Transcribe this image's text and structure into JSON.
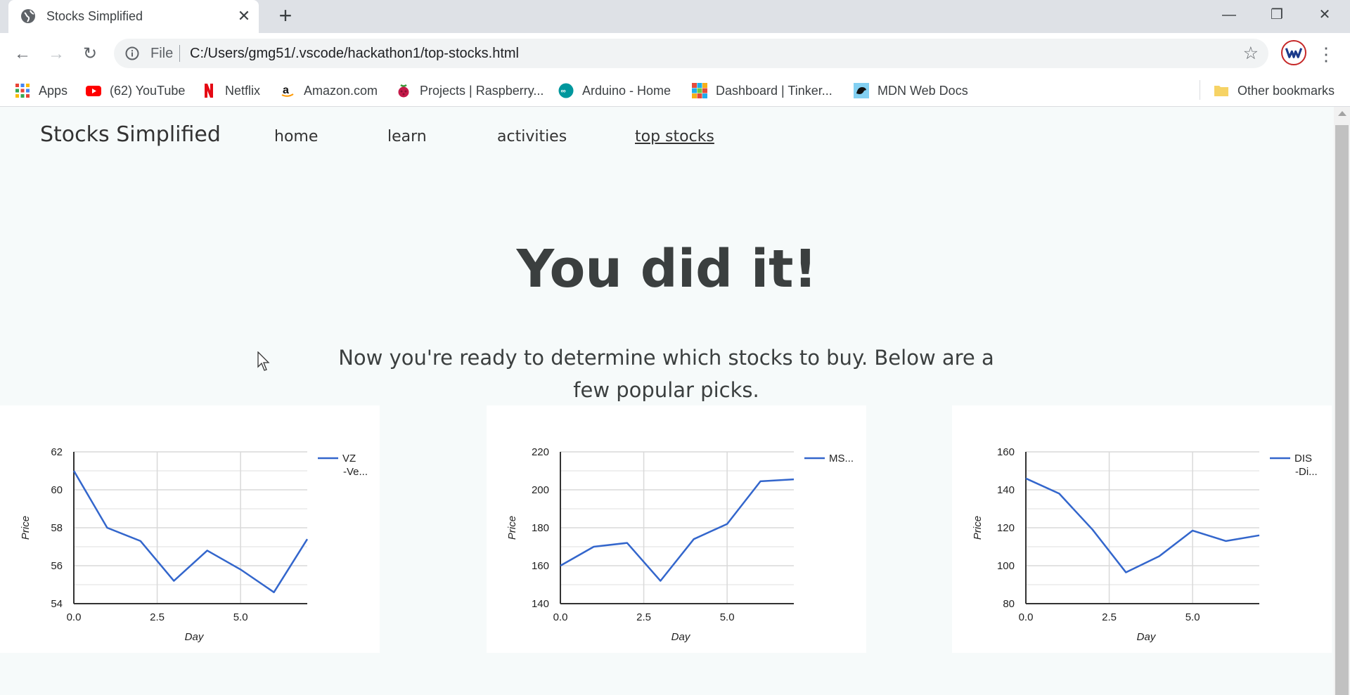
{
  "browser": {
    "tab_title": "Stocks Simplified",
    "omnibox_scheme": "File",
    "url": "C:/Users/gmg51/.vscode/hackathon1/top-stocks.html",
    "bookmarks": [
      {
        "label": "Apps",
        "icon": "apps-grid-icon"
      },
      {
        "label": "(62) YouTube",
        "icon": "youtube-icon"
      },
      {
        "label": "Netflix",
        "icon": "netflix-icon"
      },
      {
        "label": "Amazon.com",
        "icon": "amazon-icon"
      },
      {
        "label": "Projects | Raspberry...",
        "icon": "raspberry-pi-icon"
      },
      {
        "label": "Arduino - Home",
        "icon": "arduino-icon"
      },
      {
        "label": "Dashboard | Tinker...",
        "icon": "tinkercad-icon"
      },
      {
        "label": "MDN Web Docs",
        "icon": "mdn-icon"
      }
    ],
    "other_bookmarks": "Other bookmarks"
  },
  "site": {
    "brand": "Stocks Simplified",
    "nav": [
      "home",
      "learn",
      "activities",
      "top stocks"
    ],
    "active_nav": "top stocks"
  },
  "hero": {
    "title": "You did it!",
    "subtitle": "Now you're ready to determine which stocks to buy. Below are a few popular picks."
  },
  "chart_data": [
    {
      "type": "line",
      "x": [
        0,
        1,
        2,
        3,
        4,
        5,
        6,
        7
      ],
      "series": [
        {
          "name": "VZ -Ve...",
          "values": [
            61.0,
            58.0,
            57.3,
            55.2,
            56.8,
            55.8,
            54.6,
            57.4
          ],
          "color": "#3366cc"
        }
      ],
      "xlabel": "Day",
      "ylabel": "Price",
      "xlim": [
        0,
        7
      ],
      "ylim": [
        54,
        62
      ],
      "xticks": [
        "0.0",
        "2.5",
        "5.0"
      ],
      "yticks": [
        "62",
        "60",
        "58",
        "56",
        "54"
      ],
      "grid": true,
      "legend": "right"
    },
    {
      "type": "line",
      "x": [
        0,
        1,
        2,
        3,
        4,
        5,
        6,
        7
      ],
      "series": [
        {
          "name": "MS...",
          "values": [
            160,
            170,
            172,
            152,
            174,
            182,
            204.5,
            205.5
          ],
          "color": "#3366cc"
        }
      ],
      "xlabel": "Day",
      "ylabel": "Price",
      "xlim": [
        0,
        7
      ],
      "ylim": [
        140,
        220
      ],
      "xticks": [
        "0.0",
        "2.5",
        "5.0"
      ],
      "yticks": [
        "220",
        "200",
        "180",
        "160",
        "140"
      ],
      "grid": true,
      "legend": "right"
    },
    {
      "type": "line",
      "x": [
        0,
        1,
        2,
        3,
        4,
        5,
        6,
        7
      ],
      "series": [
        {
          "name": "DIS -Di...",
          "values": [
            146,
            138,
            119,
            96.5,
            105,
            118.5,
            113,
            116
          ],
          "color": "#3366cc"
        }
      ],
      "xlabel": "Day",
      "ylabel": "Price",
      "xlim": [
        0,
        7
      ],
      "ylim": [
        80,
        160
      ],
      "xticks": [
        "0.0",
        "2.5",
        "5.0"
      ],
      "yticks": [
        "160",
        "140",
        "120",
        "100",
        "80"
      ],
      "grid": true,
      "legend": "right"
    }
  ]
}
